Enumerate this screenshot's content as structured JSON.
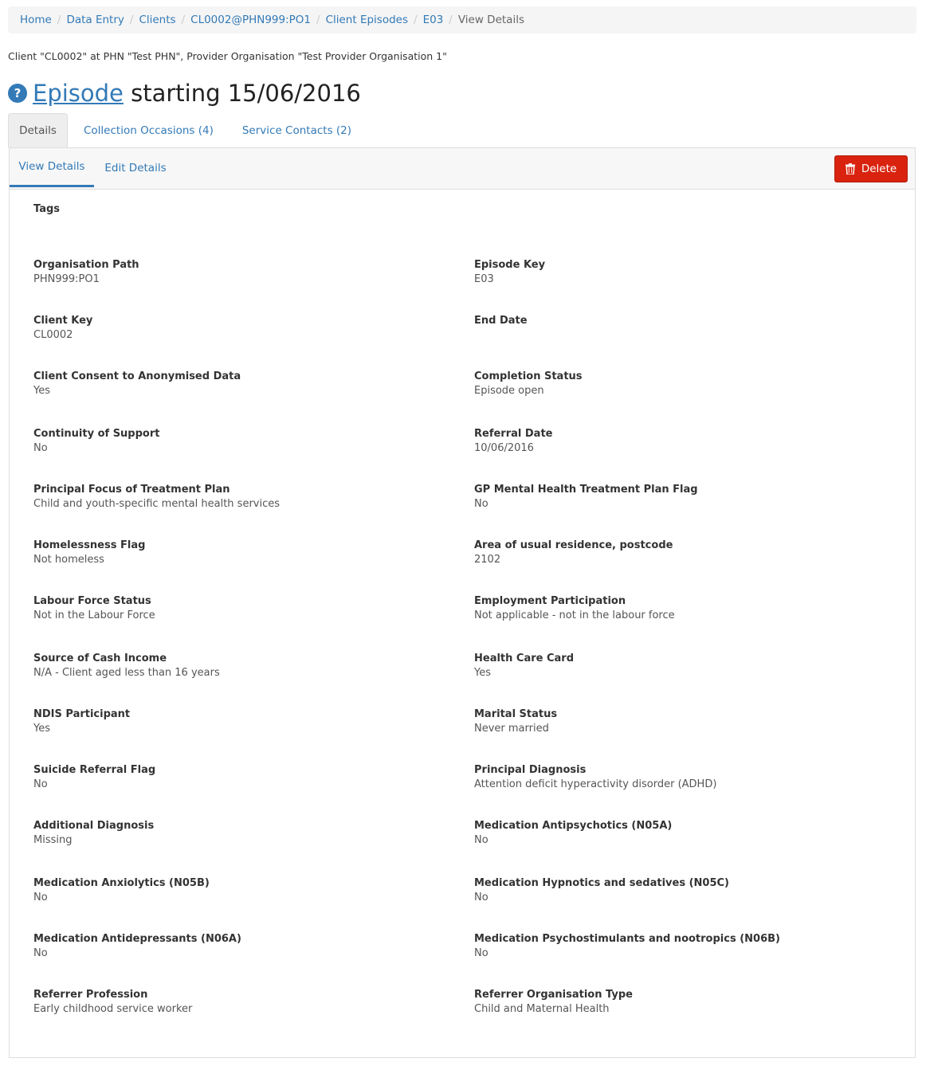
{
  "breadcrumb": {
    "items": [
      "Home",
      "Data Entry",
      "Clients",
      "CL0002@PHN999:PO1",
      "Client Episodes",
      "E03"
    ],
    "current": "View Details"
  },
  "client_line": "Client \"CL0002\" at PHN \"Test PHN\", Provider Organisation \"Test Provider Organisation 1\"",
  "title": {
    "link": "Episode",
    "rest": " starting 15/06/2016",
    "help": "?"
  },
  "tabs": [
    "Details",
    "Collection Occasions (4)",
    "Service Contacts (2)"
  ],
  "subtabs": [
    "View Details",
    "Edit Details"
  ],
  "delete_label": "Delete",
  "tags_label": "Tags",
  "fields": [
    {
      "label": "Organisation Path",
      "value": "PHN999:PO1"
    },
    {
      "label": "Episode Key",
      "value": "E03"
    },
    {
      "label": "Client Key",
      "value": "CL0002"
    },
    {
      "label": "End Date",
      "value": ""
    },
    {
      "label": "Client Consent to Anonymised Data",
      "value": "Yes"
    },
    {
      "label": "Completion Status",
      "value": "Episode open"
    },
    {
      "label": "Continuity of Support",
      "value": "No"
    },
    {
      "label": "Referral Date",
      "value": "10/06/2016"
    },
    {
      "label": "Principal Focus of Treatment Plan",
      "value": "Child and youth-specific mental health services"
    },
    {
      "label": "GP Mental Health Treatment Plan Flag",
      "value": "No"
    },
    {
      "label": "Homelessness Flag",
      "value": "Not homeless"
    },
    {
      "label": "Area of usual residence, postcode",
      "value": "2102"
    },
    {
      "label": "Labour Force Status",
      "value": "Not in the Labour Force"
    },
    {
      "label": "Employment Participation",
      "value": "Not applicable - not in the labour force"
    },
    {
      "label": "Source of Cash Income",
      "value": "N/A - Client aged less than 16 years"
    },
    {
      "label": "Health Care Card",
      "value": "Yes"
    },
    {
      "label": "NDIS Participant",
      "value": "Yes"
    },
    {
      "label": "Marital Status",
      "value": "Never married"
    },
    {
      "label": "Suicide Referral Flag",
      "value": "No"
    },
    {
      "label": "Principal Diagnosis",
      "value": "Attention deficit hyperactivity disorder (ADHD)"
    },
    {
      "label": "Additional Diagnosis",
      "value": "Missing"
    },
    {
      "label": "Medication Antipsychotics (N05A)",
      "value": "No"
    },
    {
      "label": "Medication Anxiolytics (N05B)",
      "value": "No"
    },
    {
      "label": "Medication Hypnotics and sedatives (N05C)",
      "value": "No"
    },
    {
      "label": "Medication Antidepressants (N06A)",
      "value": "No"
    },
    {
      "label": "Medication Psychostimulants and nootropics (N06B)",
      "value": "No"
    },
    {
      "label": "Referrer Profession",
      "value": "Early childhood service worker"
    },
    {
      "label": "Referrer Organisation Type",
      "value": "Child and Maternal Health"
    }
  ]
}
